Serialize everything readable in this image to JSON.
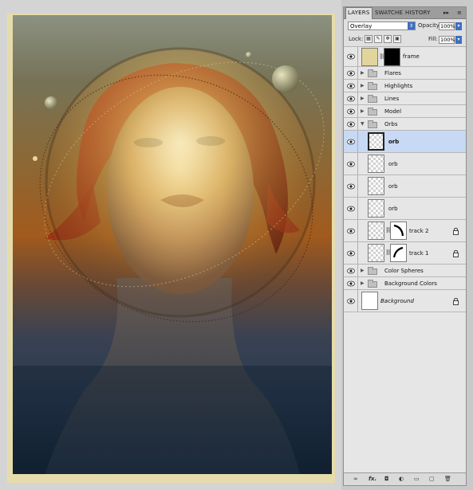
{
  "panel": {
    "tabs": [
      {
        "label": "LAYERS",
        "active": true
      },
      {
        "label": "SWATCHE",
        "active": false
      },
      {
        "label": "HISTORY",
        "active": false
      }
    ],
    "tab_controls": [
      "▸▸",
      "≡"
    ],
    "blend_mode": "Overlay",
    "opacity_label": "Opacity:",
    "opacity_value": "100%",
    "lock_label": "Lock:",
    "fill_label": "Fill:",
    "fill_value": "100%",
    "layers": [
      {
        "name": "frame",
        "type": "layer",
        "visible": true,
        "thumb": "frame",
        "mask": true,
        "indent": false,
        "selected": false,
        "italic": false,
        "locked": false
      },
      {
        "name": "Flares",
        "type": "group",
        "expanded": false,
        "visible": true
      },
      {
        "name": "Highlights",
        "type": "group",
        "expanded": false,
        "visible": true
      },
      {
        "name": "Lines",
        "type": "group",
        "expanded": false,
        "visible": true
      },
      {
        "name": "Model",
        "type": "group",
        "expanded": false,
        "visible": true
      },
      {
        "name": "Orbs",
        "type": "group",
        "expanded": true,
        "visible": true
      },
      {
        "name": "orb",
        "type": "layer",
        "visible": true,
        "indent": true,
        "selected": true,
        "bold": true
      },
      {
        "name": "orb",
        "type": "layer",
        "visible": true,
        "indent": true
      },
      {
        "name": "orb",
        "type": "layer",
        "visible": true,
        "indent": true
      },
      {
        "name": "orb",
        "type": "layer",
        "visible": true,
        "indent": true
      },
      {
        "name": "track 2",
        "type": "layer",
        "visible": true,
        "indent": true,
        "mask": true,
        "locked": true
      },
      {
        "name": "track 1",
        "type": "layer",
        "visible": true,
        "indent": true,
        "mask": true,
        "locked": true
      },
      {
        "name": "Color Spheres",
        "type": "group",
        "expanded": false,
        "visible": true
      },
      {
        "name": "Background Colors",
        "type": "group",
        "expanded": false,
        "visible": true
      },
      {
        "name": "Background",
        "type": "background",
        "visible": true,
        "italic": true,
        "locked": true
      }
    ],
    "footer_icons": [
      "link-icon",
      "fx-icon",
      "mask-icon",
      "adjustment-icon",
      "group-icon",
      "new-layer-icon",
      "trash-icon"
    ],
    "footer_labels": {
      "fx": "fx."
    }
  },
  "colors": {
    "frame_border": "#e6dcab",
    "selected_row": "#c7d9f4",
    "accent_blue": "#3d6fc4"
  }
}
